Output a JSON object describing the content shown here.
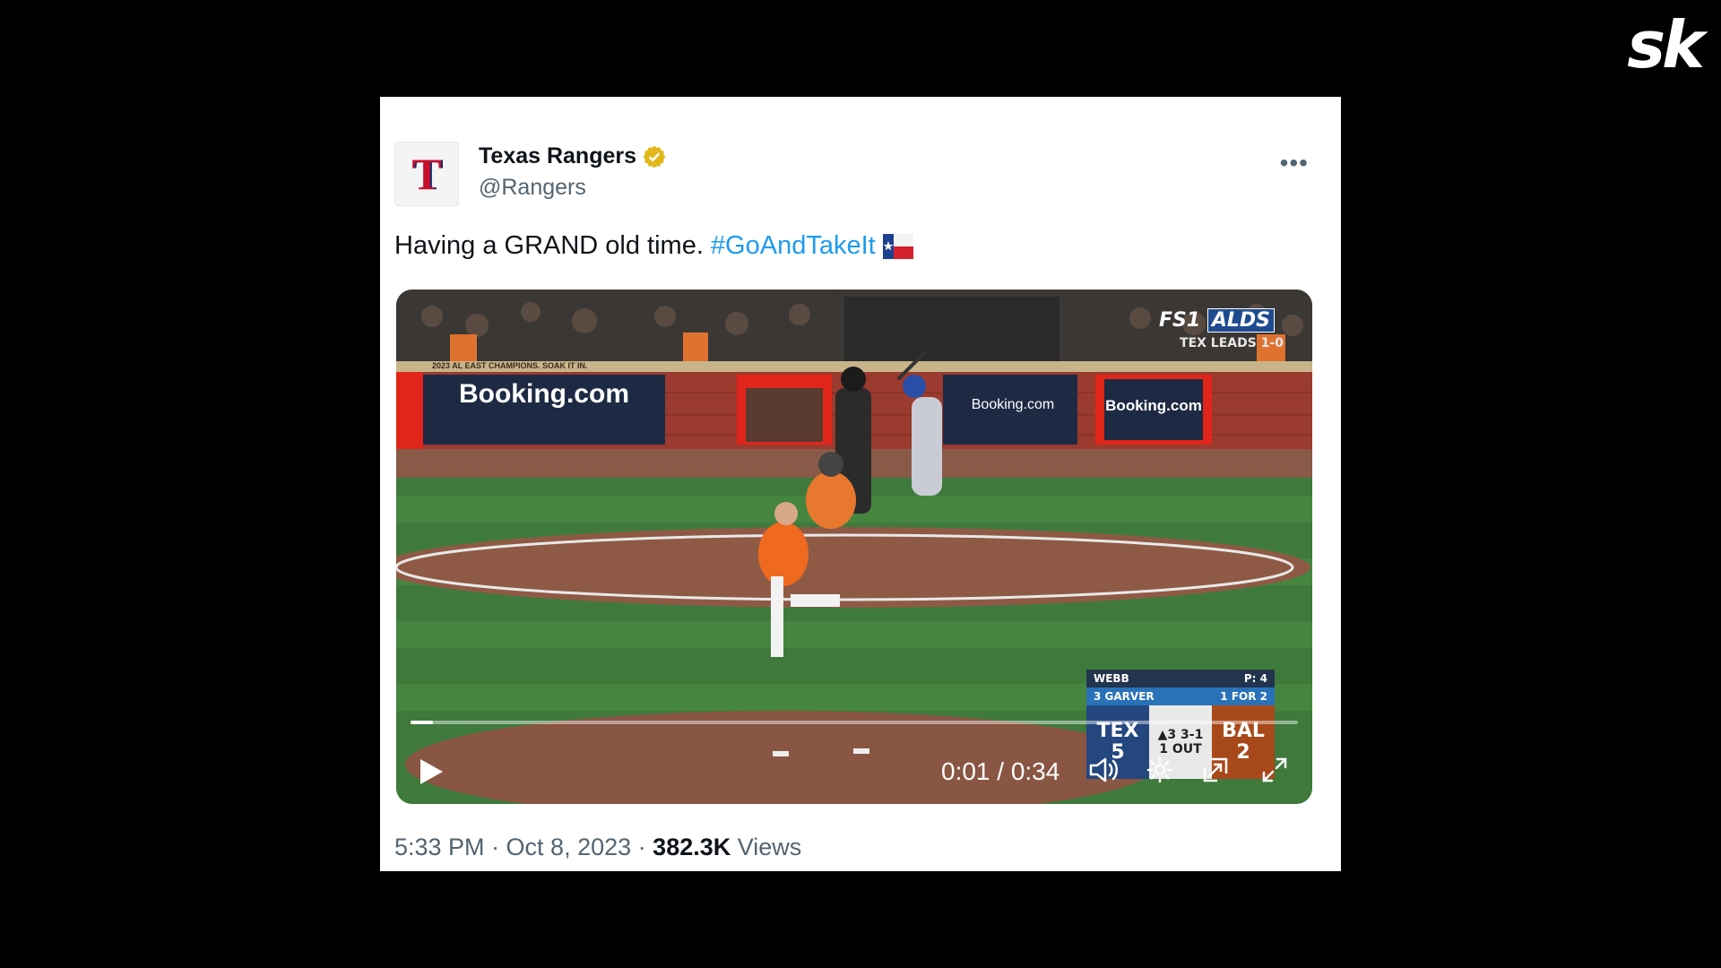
{
  "brand": {
    "logo_text": "sk"
  },
  "tweet": {
    "display_name": "Texas Rangers",
    "handle": "@Rangers",
    "avatar_letter": "T",
    "text": "Having a GRAND old time.",
    "hashtag": "#GoAndTakeIt",
    "flag_icon": "texas-flag-icon",
    "timestamp": "5:33 PM · Oct 8, 2023",
    "separator": "·",
    "views_count": "382.3K",
    "views_label": "Views",
    "more_label": "•••"
  },
  "video": {
    "current_time": "0:01",
    "duration": "0:34",
    "time_display": "0:01 / 0:34",
    "progress_fraction": 0.025,
    "ads": [
      "Booking.com",
      "Booking.com",
      "Booking.com"
    ],
    "banner_text": "2023 AL EAST CHAMPIONS. SOAK IT IN.",
    "network": {
      "fs1": "FS1",
      "alds": "ALDS",
      "series": "TEX LEADS 1-0"
    },
    "scorebug": {
      "pitcher": "WEBB",
      "pitch_count": "P: 4",
      "batter": "3 GARVER",
      "batter_stat": "1 FOR 2",
      "away_team": "TEX",
      "away_score": "5",
      "home_team": "BAL",
      "home_score": "2",
      "inning": "▲3",
      "count": "3-1",
      "outs": "1 OUT"
    }
  },
  "colors": {
    "accent": "#1d9bf0",
    "verified": "#e2b719",
    "text": "#0f1419",
    "muted": "#536471"
  }
}
